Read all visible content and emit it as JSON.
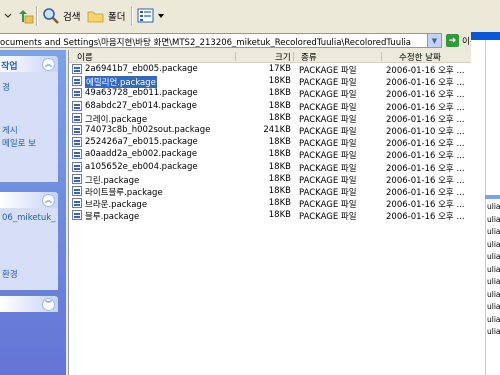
{
  "toolbar": {
    "search_label": "검색",
    "folders_label": "폴더"
  },
  "address": {
    "path": "ocuments and Settings\\마음지현\\바탕 화면\\MTS2_213206_miketuk_RecoloredTuulia\\RecoloredTuulia",
    "go_label": "이동"
  },
  "sidebar": {
    "panel1": {
      "title": "작업",
      "links": [
        "경",
        "게시",
        "메일로 보"
      ]
    },
    "panel2": {
      "links": [
        "06_miketuk_",
        "환경"
      ]
    }
  },
  "columns": {
    "name": "이름",
    "size": "크기",
    "type": "종류",
    "modified": "수정한 날짜"
  },
  "files": [
    {
      "name": "2a6941b7_eb005.package",
      "size": "17KB",
      "type": "PACKAGE 파일",
      "date": "2006-01-16 오후 ..."
    },
    {
      "name": "에밀리언.package",
      "size": "18KB",
      "type": "PACKAGE 파일",
      "date": "2006-01-16 오후 ..."
    },
    {
      "name": "49a63728_eb011.package",
      "size": "18KB",
      "type": "PACKAGE 파일",
      "date": "2006-01-16 오후 ..."
    },
    {
      "name": "68abdc27_eb014.package",
      "size": "18KB",
      "type": "PACKAGE 파일",
      "date": "2006-01-16 오후 ..."
    },
    {
      "name": "그레이.package",
      "size": "18KB",
      "type": "PACKAGE 파일",
      "date": "2006-01-16 오후 ..."
    },
    {
      "name": "74073c8b_h002sout.package",
      "size": "241KB",
      "type": "PACKAGE 파일",
      "date": "2006-01-10 오후 ..."
    },
    {
      "name": "252426a7_eb015.package",
      "size": "18KB",
      "type": "PACKAGE 파일",
      "date": "2006-01-16 오후 ..."
    },
    {
      "name": "a0aadd2a_eb002.package",
      "size": "18KB",
      "type": "PACKAGE 파일",
      "date": "2006-01-16 오후 ..."
    },
    {
      "name": "a105652e_eb004.package",
      "size": "18KB",
      "type": "PACKAGE 파일",
      "date": "2006-01-16 오후 ..."
    },
    {
      "name": "그린.package",
      "size": "18KB",
      "type": "PACKAGE 파일",
      "date": "2006-01-16 오후 ..."
    },
    {
      "name": "라이트블루.package",
      "size": "18KB",
      "type": "PACKAGE 파일",
      "date": "2006-01-16 오후 ..."
    },
    {
      "name": "브라운.package",
      "size": "18KB",
      "type": "PACKAGE 파일",
      "date": "2006-01-16 오후 ..."
    },
    {
      "name": "블루.package",
      "size": "18KB",
      "type": "PACKAGE 파일",
      "date": "2006-01-16 오후 ..."
    }
  ],
  "selected_file": "에밀리언.package",
  "right_window": {
    "items": [
      "ulia",
      "ulia",
      "ulia",
      "ulia",
      "ulia",
      "ulia",
      "ulia",
      "ulia",
      "ulia",
      "ulia",
      "ulia"
    ]
  },
  "colors": {
    "selection": "#316ac5",
    "sidebar_top": "#7ba2e7",
    "sidebar_bottom": "#6375d6",
    "link": "#215dc6"
  }
}
